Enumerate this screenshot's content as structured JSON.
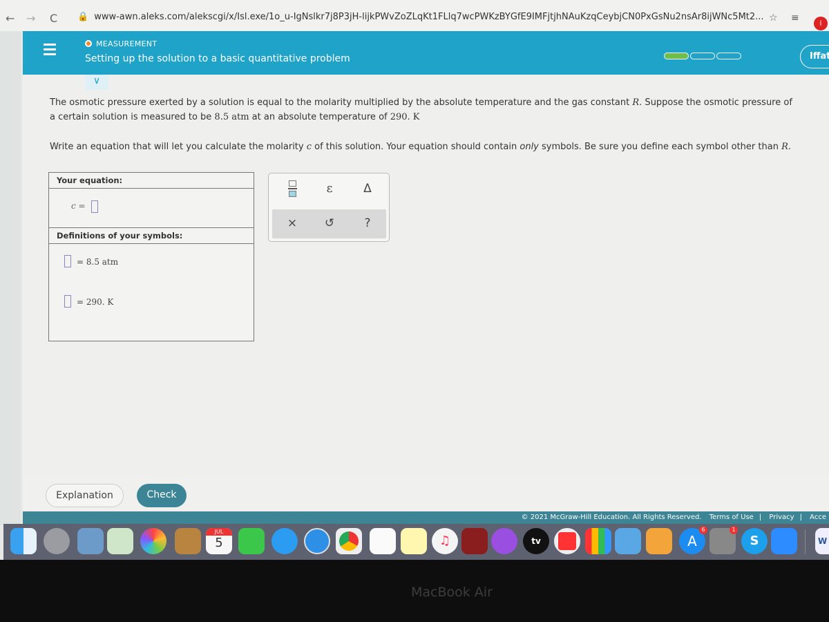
{
  "browser": {
    "url": "www-awn.aleks.com/alekscgi/x/Isl.exe/1o_u-IgNslkr7j8P3jH-lijkPWvZoZLqKt1FLlq7wcPWKzBYGfE9IMFjtjhNAuKzqCeybjCN0PxGsNu2nsAr8ijWNc5Mt2...",
    "avatar_letter": "i"
  },
  "header": {
    "topic": "MEASUREMENT",
    "title": "Setting up the solution to a basic quantitative problem",
    "user": "Iffat",
    "progress": {
      "filled": 1,
      "total": 3
    }
  },
  "problem": {
    "p1a": "The osmotic pressure exerted by a solution is equal to the molarity multiplied by the absolute temperature and the gas constant ",
    "p1R": "R",
    "p1b": ". Suppose the osmotic pressure of a certain solution is measured to be ",
    "p1val1": "8.5 atm",
    "p1c": " at an absolute temperature of ",
    "p1val2": "290. K",
    "p2a": "Write an equation that will let you calculate the molarity ",
    "p2c": "c",
    "p2b": " of this solution. Your equation should contain ",
    "p2only": "only",
    "p2d": " symbols. Be sure you define each symbol other than ",
    "p2R": "R"
  },
  "answer": {
    "equation_label": "Your equation:",
    "lhs": "c =",
    "definitions_label": "Definitions of your symbols:",
    "def1": "= 8.5 atm",
    "def2": "= 290. K"
  },
  "keypad": {
    "keys": [
      "fraction",
      "ε",
      "Δ",
      "×",
      "↺",
      "?"
    ]
  },
  "buttons": {
    "explanation": "Explanation",
    "check": "Check"
  },
  "footer": {
    "copyright": "© 2021 McGraw-Hill Education. All Rights Reserved.",
    "terms": "Terms of Use",
    "privacy": "Privacy",
    "access": "Acce"
  },
  "dock": {
    "calendar_month": "JUL",
    "calendar_day": "5",
    "appstore_badge": "6",
    "sysprefs_badge": "1",
    "tv_label": "tv",
    "skype_label": "S",
    "word_label": "W"
  },
  "device": {
    "label": "MacBook Air"
  }
}
